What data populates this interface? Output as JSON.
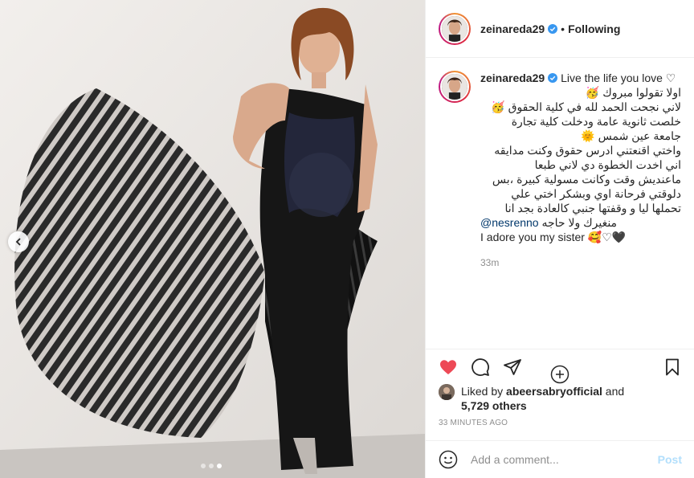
{
  "header": {
    "username": "zeinareda29",
    "separator": "•",
    "follow_status": "Following"
  },
  "caption": {
    "username": "zeinareda29",
    "lines": [
      "Live the life you love ♡",
      "اولا تقولوا مبروك 🥳",
      "لاني نجحت الحمد لله في كلية الحقوق 🥳",
      "خلصت ثانوية عامة ودخلت كلية تجارة",
      "جامعة عين شمس 🌞",
      "واختي اقنعتني ادرس حقوق وكنت مدايقه",
      "اني اخدت الخطوة دي لاني طبعا",
      "ماعنديش وقت وكانت مسولية كبيرة ،بس",
      "دلوقتي فرحانة اوي وبشكر اختي علي",
      "تحملها ليا و وقفتها جنبي كالعادة بجد انا",
      "منغيرك ولا حاجه"
    ],
    "mention": "@nesrenno",
    "last_line": "I adore you my sister 🥰♡🖤",
    "time_ago": "33m"
  },
  "likes": {
    "prefix": "Liked by",
    "user": "abeersabryofficial",
    "conjunction": "and",
    "others": "5,729 others"
  },
  "posted_time": "33 MINUTES AGO",
  "comment_box": {
    "placeholder": "Add a comment...",
    "post_label": "Post"
  },
  "colors": {
    "heart": "#ed4956",
    "link": "#00376b",
    "post_disabled": "#b2dffc",
    "verified": "#3897f0"
  },
  "carousel": {
    "count": 3,
    "active_index": 2
  }
}
